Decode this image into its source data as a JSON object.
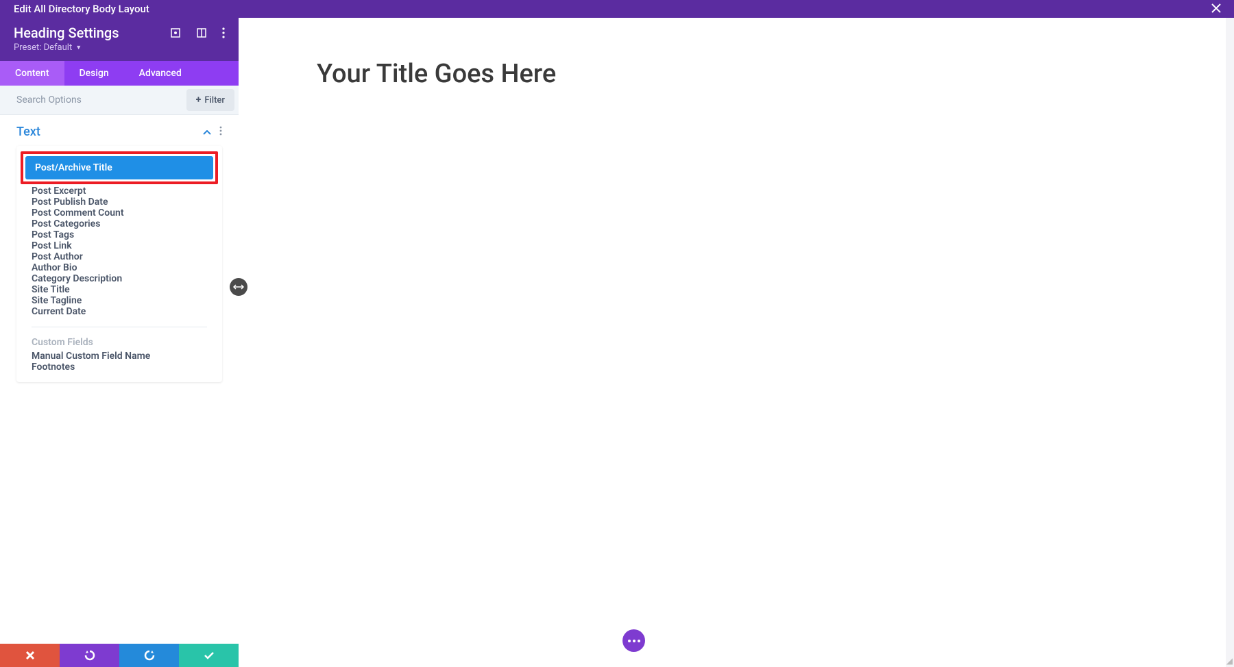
{
  "topbar": {
    "title": "Edit All Directory Body Layout"
  },
  "sidehead": {
    "title": "Heading Settings",
    "preset": "Preset: Default"
  },
  "tabs": [
    {
      "label": "Content",
      "active": true
    },
    {
      "label": "Design",
      "active": false
    },
    {
      "label": "Advanced",
      "active": false
    }
  ],
  "search": {
    "placeholder": "Search Options",
    "filter_label": "Filter"
  },
  "section": {
    "title": "Text"
  },
  "options": [
    {
      "label": "Post/Archive Title",
      "selected": true,
      "highlighted": true
    },
    {
      "label": "Post Excerpt",
      "selected": false,
      "highlighted": false
    },
    {
      "label": "Post Publish Date",
      "selected": false,
      "highlighted": false
    },
    {
      "label": "Post Comment Count",
      "selected": false,
      "highlighted": false
    },
    {
      "label": "Post Categories",
      "selected": false,
      "highlighted": false
    },
    {
      "label": "Post Tags",
      "selected": false,
      "highlighted": false
    },
    {
      "label": "Post Link",
      "selected": false,
      "highlighted": false
    },
    {
      "label": "Post Author",
      "selected": false,
      "highlighted": false
    },
    {
      "label": "Author Bio",
      "selected": false,
      "highlighted": false
    },
    {
      "label": "Category Description",
      "selected": false,
      "highlighted": false
    },
    {
      "label": "Site Title",
      "selected": false,
      "highlighted": false
    },
    {
      "label": "Site Tagline",
      "selected": false,
      "highlighted": false
    },
    {
      "label": "Current Date",
      "selected": false,
      "highlighted": false
    }
  ],
  "custom_header": "Custom Fields",
  "custom_options": [
    {
      "label": "Manual Custom Field Name"
    },
    {
      "label": "Footnotes"
    }
  ],
  "canvas": {
    "heading": "Your Title Goes Here"
  }
}
